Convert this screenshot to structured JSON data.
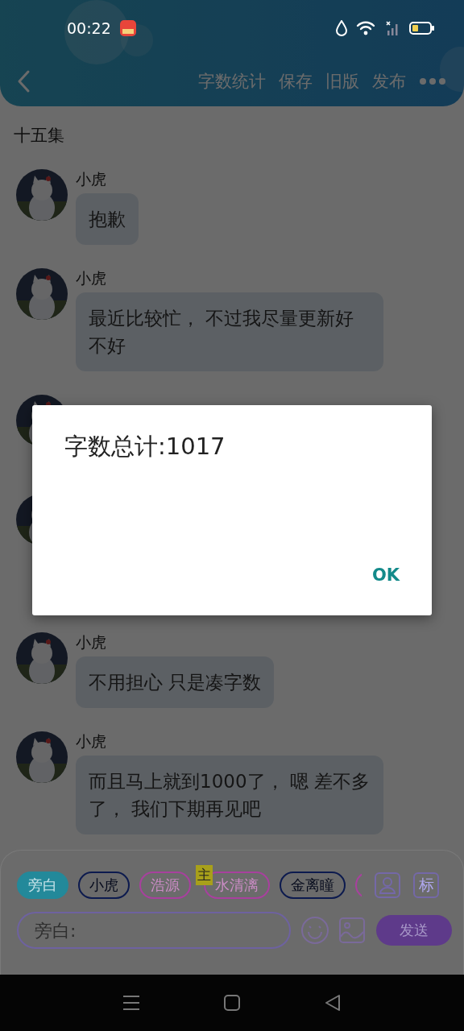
{
  "status_bar": {
    "time": "00:22"
  },
  "toolbar": {
    "actions": [
      "字数统计",
      "保存",
      "旧版",
      "发布"
    ]
  },
  "episode_title": "十五集",
  "messages": [
    {
      "sender": "小虎",
      "text": "抱歉"
    },
    {
      "sender": "小虎",
      "text": "最近比较忙， 不过我尽量更新好不好"
    },
    {
      "kind": "hidden"
    },
    {
      "kind": "hidden_tall"
    },
    {
      "sender": "小虎",
      "text": "不用担心 只是凑字数"
    },
    {
      "sender": "小虎",
      "text": "而且马上就到1000了， 嗯 差不多了， 我们下期再见吧"
    }
  ],
  "role_tags": [
    {
      "label": "旁白",
      "selected": true,
      "color": "#23899a"
    },
    {
      "label": "小虎",
      "selected": false,
      "color": "#0c1a4e"
    },
    {
      "label": "浩源",
      "selected": false,
      "color": "#a8409e"
    },
    {
      "label": "水清漓",
      "selected": false,
      "color": "#a8409e",
      "badge": "主"
    },
    {
      "label": "金离瞳",
      "selected": false,
      "color": "#0c1a4e"
    },
    {
      "kind": "cut",
      "selected": false,
      "color": "#a8409e"
    }
  ],
  "tag_button": "标",
  "composer": {
    "placeholder": "旁白:",
    "send": "发送"
  },
  "dialog": {
    "message": "字数总计:1017",
    "button": "OK"
  }
}
